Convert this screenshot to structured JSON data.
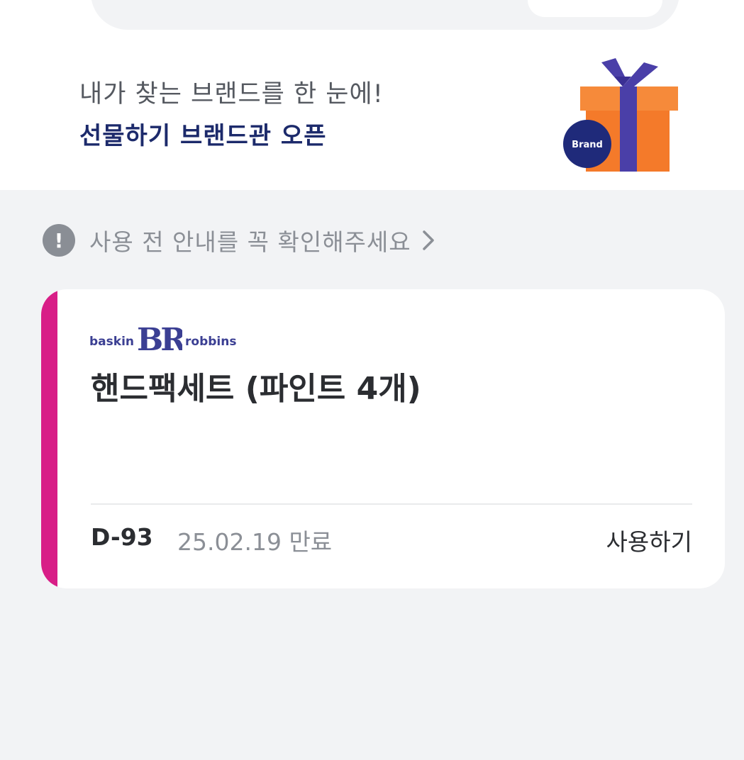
{
  "banner": {
    "subtitle": "내가 찾는 브랜드를 한 눈에!",
    "title": "선물하기 브랜드관 오픈",
    "badge_label": "Brand",
    "icon": "gift-box-icon",
    "colors": {
      "gift_orange": "#f47a2a",
      "ribbon_purple": "#4a3fa8",
      "badge_navy": "#1f2a7a"
    }
  },
  "notice": {
    "icon": "exclamation-circle-icon",
    "text": "사용 전 안내를 꼭 확인해주세요",
    "chevron_icon": "chevron-right-icon"
  },
  "coupon": {
    "brand": {
      "left_word": "baskin",
      "monogram": "BR",
      "right_word": "robbins"
    },
    "title": "핸드팩세트 (파인트 4개)",
    "dday": "D-93",
    "expiry": "25.02.19  만료",
    "use_label": "사용하기",
    "accent_color": "#d81e87"
  }
}
